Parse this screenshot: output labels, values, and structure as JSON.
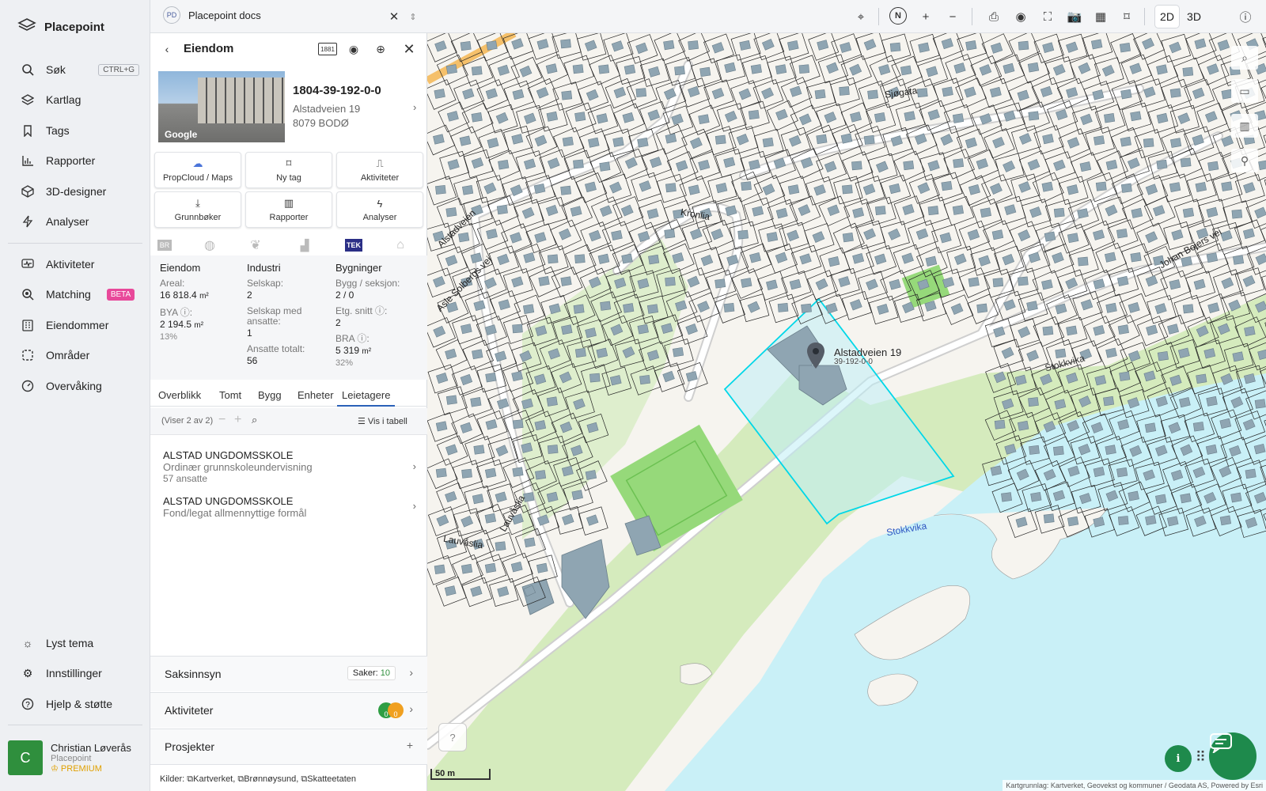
{
  "app": {
    "name": "Placepoint"
  },
  "nav": {
    "items": [
      {
        "label": "Søk",
        "shortcut": "CTRL+G",
        "icon": "search-icon"
      },
      {
        "label": "Kartlag",
        "icon": "layers-icon"
      },
      {
        "label": "Tags",
        "icon": "bookmark-icon"
      },
      {
        "label": "Rapporter",
        "icon": "bar-chart-icon"
      },
      {
        "label": "3D-designer",
        "icon": "cube-icon"
      },
      {
        "label": "Analyser",
        "icon": "bolt-icon"
      },
      {
        "label": "Aktiviteter",
        "icon": "activity-icon"
      },
      {
        "label": "Matching",
        "badge": "BETA",
        "icon": "match-icon"
      },
      {
        "label": "Eiendommer",
        "icon": "building-icon"
      },
      {
        "label": "Områder",
        "icon": "area-icon"
      },
      {
        "label": "Overvåking",
        "icon": "gauge-icon"
      }
    ],
    "bottom": [
      {
        "label": "Lyst tema",
        "icon": "sun-icon"
      },
      {
        "label": "Innstillinger",
        "icon": "gear-icon"
      },
      {
        "label": "Hjelp & støtte",
        "icon": "help-icon"
      }
    ],
    "user": {
      "initial": "C",
      "name": "Christian Løverås",
      "org": "Placepoint",
      "plan": "PREMIUM"
    }
  },
  "topbar": {
    "doc_badge": "PD",
    "doc_title": "Placepoint docs",
    "mode_2d": "2D",
    "mode_3d": "3D",
    "compass": "N"
  },
  "panel": {
    "title": "Eiendom",
    "badge_1881": "1881",
    "property_id": "1804-39-192-0-0",
    "address_line1": "Alstadveien 19",
    "address_line2": "8079 BODØ",
    "photo_credit": "Google",
    "actions": [
      {
        "label": "PropCloud / Maps",
        "icon": "cloud-icon"
      },
      {
        "label": "Ny tag",
        "icon": "bookmark-icon"
      },
      {
        "label": "Aktiviteter",
        "icon": "activity-icon"
      },
      {
        "label": "Grunnbøker",
        "icon": "download-icon"
      },
      {
        "label": "Rapporter",
        "icon": "bar-chart-icon"
      },
      {
        "label": "Analyser",
        "icon": "bolt-icon"
      }
    ],
    "source_badges": {
      "br": "BR",
      "tek": "TEK"
    },
    "facts": {
      "eiendom": {
        "heading": "Eiendom",
        "areal_label": "Areal:",
        "areal_value": "16 818.4",
        "areal_unit": "m²",
        "bya_label": "BYA ⓘ:",
        "bya_value": "2 194.5",
        "bya_unit": "m²",
        "bya_pct": "13%"
      },
      "industri": {
        "heading": "Industri",
        "selskap_label": "Selskap:",
        "selskap_value": "2",
        "ansatte_label": "Selskap med ansatte:",
        "ansatte_value": "1",
        "total_label": "Ansatte totalt:",
        "total_value": "56"
      },
      "bygninger": {
        "heading": "Bygninger",
        "bygg_label": "Bygg / seksjon:",
        "bygg_value": "2 / 0",
        "etg_label": "Etg. snitt ⓘ:",
        "etg_value": "2",
        "bra_label": "BRA ⓘ:",
        "bra_value": "5 319",
        "bra_unit": "m²",
        "bra_pct": "32%"
      }
    },
    "tabs": [
      "Overblikk",
      "Tomt",
      "Bygg",
      "Enheter",
      "Leietagere"
    ],
    "active_tab": "Leietagere",
    "list_info": "(Viser 2 av 2)",
    "table_view": "Vis i tabell",
    "tenants": [
      {
        "name": "ALSTAD UNGDOMSSKOLE",
        "desc": "Ordinær grunnskoleundervisning",
        "count": "57 ansatte"
      },
      {
        "name": "ALSTAD UNGDOMSSKOLE",
        "desc": "Fond/legat allmennyttige formål",
        "count": ""
      }
    ],
    "sections": {
      "saksinnsyn": {
        "label": "Saksinnsyn",
        "badge_label": "Saker:",
        "badge_value": "10"
      },
      "aktiviteter": {
        "label": "Aktiviteter",
        "count_a": "0",
        "count_b": "0"
      },
      "prosjekter": {
        "label": "Prosjekter"
      }
    },
    "sources_label": "Kilder:",
    "sources": [
      "Kartverket,",
      "Brønnøysund,",
      "Skatteetaten"
    ]
  },
  "map": {
    "marker_label": "Alstadveien 19",
    "marker_sublabel": "39-192-0-0",
    "scale": "50 m",
    "attribution": "Kartgrunnlag: Kartverket, Geovekst og kommuner / Geodata AS, Powered by Esri",
    "place_labels": [
      "Stokkvika",
      "Stokkvika",
      "Kronlia",
      "Lauvåslia",
      "Lauvåslia",
      "Johan Bojers vei",
      "Asle Solbergs vei",
      "Alstadveien",
      "Sjøgata"
    ],
    "colors": {
      "water": "#c9f0f7",
      "green": "#b9e39b",
      "parcel": "#00d7e8",
      "building": "#8fa5b2"
    }
  }
}
